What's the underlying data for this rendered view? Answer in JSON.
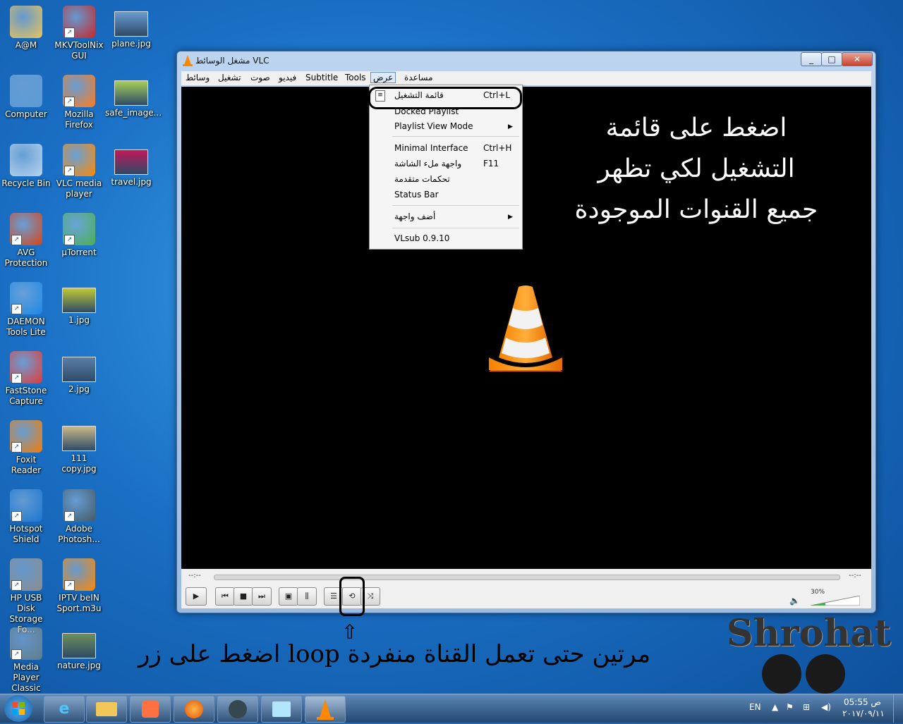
{
  "desktop": {
    "icons": [
      {
        "label": "A@M",
        "icon": "user-folder-icon",
        "color": "#e8c45a"
      },
      {
        "label": "MKVToolNix GUI",
        "icon": "mkvtoolnix-icon",
        "color": "#c62828"
      },
      {
        "label": "plane.jpg",
        "icon": "image-thumbnail-icon",
        "color": "#6a9bd1"
      },
      {
        "label": "Computer",
        "icon": "computer-icon",
        "color": "#5b9bd5"
      },
      {
        "label": "Mozilla Firefox",
        "icon": "firefox-icon",
        "color": "#ff7a1a"
      },
      {
        "label": "safe_image...",
        "icon": "image-thumbnail-icon",
        "color": "#a6cf5a"
      },
      {
        "label": "Recycle Bin",
        "icon": "recycle-bin-icon",
        "color": "#b8d4ec"
      },
      {
        "label": "VLC media player",
        "icon": "vlc-cone-icon",
        "color": "#ff8800"
      },
      {
        "label": "travel.jpg",
        "icon": "image-thumbnail-icon",
        "color": "#c2185b"
      },
      {
        "label": "AVG Protection",
        "icon": "avg-icon",
        "color": "#d84315"
      },
      {
        "label": "µTorrent",
        "icon": "utorrent-icon",
        "color": "#4caf50"
      },
      {
        "label": "DAEMON Tools Lite",
        "icon": "daemon-tools-icon",
        "color": "#1e88e5"
      },
      {
        "label": "1.jpg",
        "icon": "image-thumbnail-icon",
        "color": "#c0ca33"
      },
      {
        "label": "FastStone Capture",
        "icon": "faststone-icon",
        "color": "#e53935"
      },
      {
        "label": "2.jpg",
        "icon": "image-thumbnail-icon",
        "color": "#5c7fa8"
      },
      {
        "label": "Foxit Reader",
        "icon": "foxit-icon",
        "color": "#f57c00"
      },
      {
        "label": "111 copy.jpg",
        "icon": "image-thumbnail-icon",
        "color": "#c9b98a"
      },
      {
        "label": "Hotspot Shield",
        "icon": "hotspot-shield-icon",
        "color": "#1976d2"
      },
      {
        "label": "Adobe Photosh...",
        "icon": "photoshop-icon",
        "color": "#455a64"
      },
      {
        "label": "HP USB Disk Storage Fo...",
        "icon": "hp-usb-icon",
        "color": "#8d8d8d"
      },
      {
        "label": "IPTV beIN Sport.m3u",
        "icon": "vlc-cone-icon",
        "color": "#ff8800"
      },
      {
        "label": "Media Player Classic",
        "icon": "media-player-classic-icon",
        "color": "#607d8b"
      },
      {
        "label": "nature.jpg",
        "icon": "image-thumbnail-icon",
        "color": "#6d8f5a"
      }
    ]
  },
  "vlc": {
    "title": "مشغل الوسائط VLC",
    "menus": [
      "وسائط",
      "تشغيل",
      "صوت",
      "فيديو",
      "Subtitle",
      "Tools",
      "عرض",
      "مساعدة"
    ],
    "time_left": "--:--",
    "time_right": "--:--",
    "volume": "30%",
    "volume_level": 0.3,
    "overlay_lines": [
      "اضغط على قائمة",
      "التشغيل لكي تظهر",
      "جميع القنوات الموجودة"
    ]
  },
  "dropdown": {
    "items": [
      {
        "label": "قائمة التشغيل",
        "shortcut": "Ctrl+L"
      },
      {
        "label": "Docked Playlist",
        "shortcut": ""
      },
      {
        "label": "Playlist View Mode",
        "shortcut": ""
      },
      {
        "label": "Minimal Interface",
        "shortcut": "Ctrl+H"
      },
      {
        "label": "واجهة ملء الشاشة",
        "shortcut": "F11"
      },
      {
        "label": "تحكمات متقدمة",
        "shortcut": ""
      },
      {
        "label": "Status Bar",
        "shortcut": ""
      },
      {
        "label": "أضف واجهة",
        "shortcut": ""
      },
      {
        "label": "VLsub 0.9.10",
        "shortcut": ""
      }
    ]
  },
  "annotation": {
    "bottom_text": "اضغط على زر loop مرتين حتى تعمل القناة منفردة",
    "watermark": "Shrohat"
  },
  "taskbar": {
    "lang": "EN",
    "time": "05:55 ص",
    "date": "٢٠١٧/٠٩/١١"
  }
}
